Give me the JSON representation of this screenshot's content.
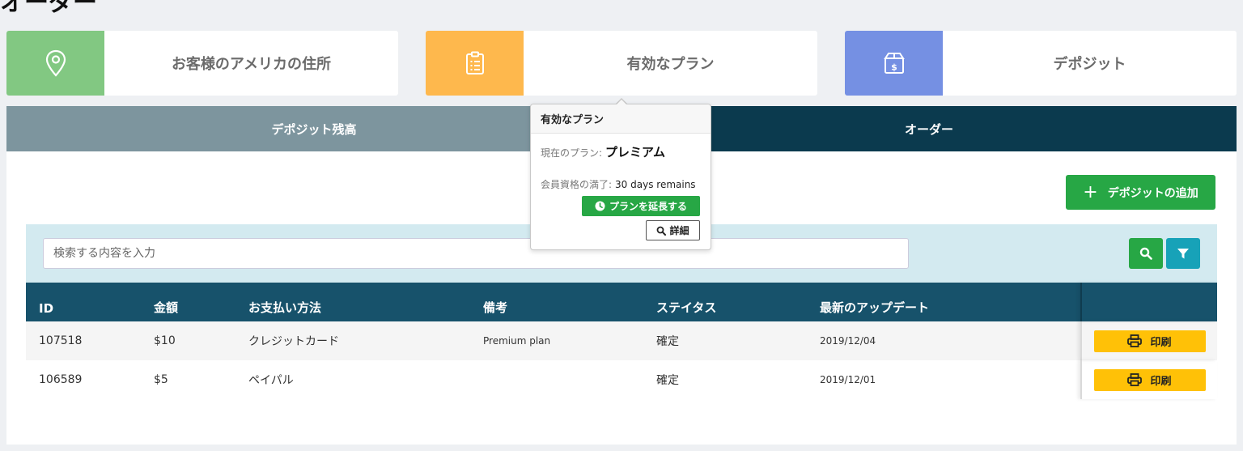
{
  "page": {
    "title": "オーダー"
  },
  "cards": {
    "address": {
      "label": "お客様のアメリカの住所",
      "icon": "map-pin-icon",
      "color": "#82c882"
    },
    "plan": {
      "label": "有効なプラン",
      "icon": "clipboard-list-icon",
      "color": "#feb84d"
    },
    "deposit": {
      "label": "デポジット",
      "icon": "dollar-box-icon",
      "color": "#7590e3"
    }
  },
  "tabs": [
    {
      "label": "デポジット残高",
      "active": false
    },
    {
      "label": "オーダー",
      "active": true
    }
  ],
  "toolbar": {
    "add_deposit_label": "デポジットの追加",
    "add_icon": "plus-icon"
  },
  "search": {
    "placeholder": "検索する内容を入力",
    "value": "",
    "search_icon": "search-icon",
    "filter_icon": "filter-icon"
  },
  "table": {
    "headers": [
      "ID",
      "金額",
      "お支払い方法",
      "備考",
      "ステイタス",
      "最新のアップデート",
      ""
    ],
    "rows": [
      {
        "id": "107518",
        "amount": "$10",
        "method": "クレジットカード",
        "note": "Premium plan",
        "status": "確定",
        "updated": "2019/12/04",
        "action": "印刷"
      },
      {
        "id": "106589",
        "amount": "$5",
        "method": "ペイパル",
        "note": "",
        "status": "確定",
        "updated": "2019/12/01",
        "action": "印刷"
      }
    ]
  },
  "popover": {
    "title": "有効なプラン",
    "current_plan_label": "現在のプラン:",
    "current_plan": "プレミアム",
    "expiry_label": "会員資格の満了:",
    "expiry_value": "30 days remains",
    "extend_label": "プランを延長する",
    "details_label": "詳細"
  },
  "colors": {
    "primary_green": "#27a745",
    "info_teal": "#17a2b8",
    "header_navy": "#17526b",
    "active_tab": "#0b3a4e",
    "print_yellow": "#ffc107"
  }
}
